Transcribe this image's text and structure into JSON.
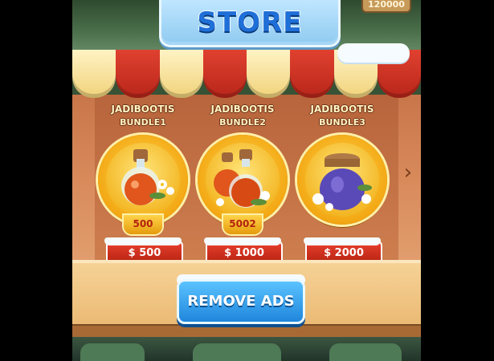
{
  "store": {
    "title": "STORE",
    "coins": "120000"
  },
  "items": [
    {
      "name": "JADIBOOTIS",
      "bundle": "BUNDLE1",
      "quantity": "500",
      "price": "$ 500",
      "art": "potion-bottle-icon"
    },
    {
      "name": "JADIBOOTIS",
      "bundle": "BUNDLE2",
      "quantity": "5002",
      "price": "$ 1000",
      "art": "two-potion-bottles-icon"
    },
    {
      "name": "JADIBOOTIS",
      "bundle": "BUNDLE3",
      "quantity": "",
      "price": "$ 2000",
      "art": "potion-jar-icon"
    }
  ],
  "remove_ads": {
    "label": "REMOVE ADS"
  },
  "colors": {
    "awning_red": "#d8392a",
    "awning_cream": "#fbe8a8",
    "medallion_gold": "#f3a814",
    "price_red": "#d2301f",
    "remove_ads_blue": "#2d9cf0"
  }
}
